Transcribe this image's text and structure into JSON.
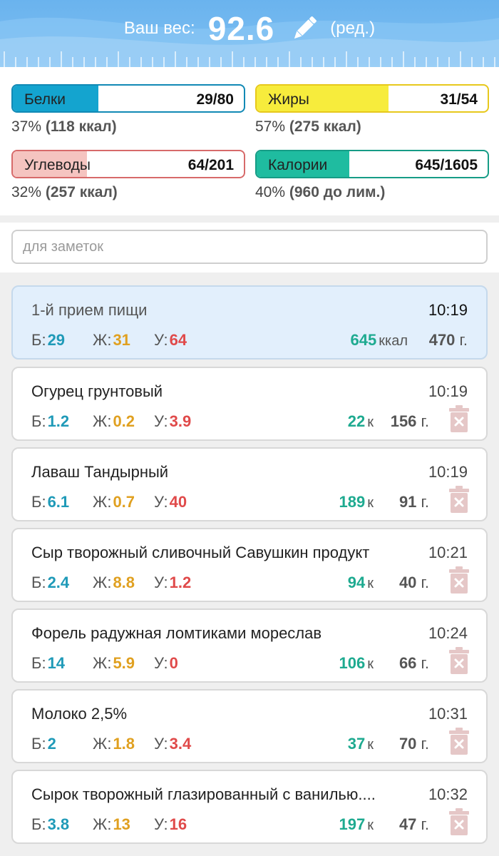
{
  "header": {
    "weight_label": "Ваш вес:",
    "weight_value": "92.6",
    "edit_label": "(ред.)"
  },
  "summary": {
    "protein": {
      "name": "Белки",
      "value": "29/80",
      "sub_pct": "37%",
      "sub_extra": "(118 ккал)",
      "fill_pct": 37,
      "color": "#14a4cf"
    },
    "fat": {
      "name": "Жиры",
      "value": "31/54",
      "sub_pct": "57%",
      "sub_extra": "(275 ккал)",
      "fill_pct": 57,
      "color": "#f7ec3c"
    },
    "carbs": {
      "name": "Углеводы",
      "value": "64/201",
      "sub_pct": "32%",
      "sub_extra": "(257 ккал)",
      "fill_pct": 32,
      "color": "#f5c4c0"
    },
    "calories": {
      "name": "Калории",
      "value": "645/1605",
      "sub_pct": "40%",
      "sub_extra": "(960 до лим.)",
      "fill_pct": 40,
      "color": "#1fbca0"
    }
  },
  "notes": {
    "placeholder": "для заметок"
  },
  "labels": {
    "p": "Б:",
    "f": "Ж:",
    "c": "У:",
    "kcal_unit": "ккал",
    "k_unit": "к",
    "g_unit": "г."
  },
  "meal": {
    "title": "1-й прием пищи",
    "time": "10:19",
    "p": "29",
    "f": "31",
    "c": "64",
    "kcal": "645",
    "grams": "470"
  },
  "foods": [
    {
      "title": "Огурец грунтовый",
      "time": "10:19",
      "p": "1.2",
      "f": "0.2",
      "c": "3.9",
      "kcal": "22",
      "grams": "156"
    },
    {
      "title": "Лаваш Тандырный",
      "time": "10:19",
      "p": "6.1",
      "f": "0.7",
      "c": "40",
      "kcal": "189",
      "grams": "91"
    },
    {
      "title": "Сыр творожный сливочный Савушкин продукт",
      "time": "10:21",
      "p": "2.4",
      "f": "8.8",
      "c": "1.2",
      "kcal": "94",
      "grams": "40"
    },
    {
      "title": "Форель радужная ломтиками мореслав",
      "time": "10:24",
      "p": "14",
      "f": "5.9",
      "c": "0",
      "kcal": "106",
      "grams": "66"
    },
    {
      "title": "Молоко 2,5%",
      "time": "10:31",
      "p": "2",
      "f": "1.8",
      "c": "3.4",
      "kcal": "37",
      "grams": "70"
    },
    {
      "title": "Сырок творожный глазированный с ванилью....",
      "time": "10:32",
      "p": "3.8",
      "f": "13",
      "c": "16",
      "kcal": "197",
      "grams": "47"
    }
  ],
  "colors": {
    "protein": "#1f9ab8",
    "fat": "#e0a020",
    "carbs": "#e04a4a",
    "kcal": "#1eaa90",
    "trash": "#e5c7c7"
  },
  "icons": {
    "edit": "pencil-icon",
    "delete": "trash-icon"
  }
}
